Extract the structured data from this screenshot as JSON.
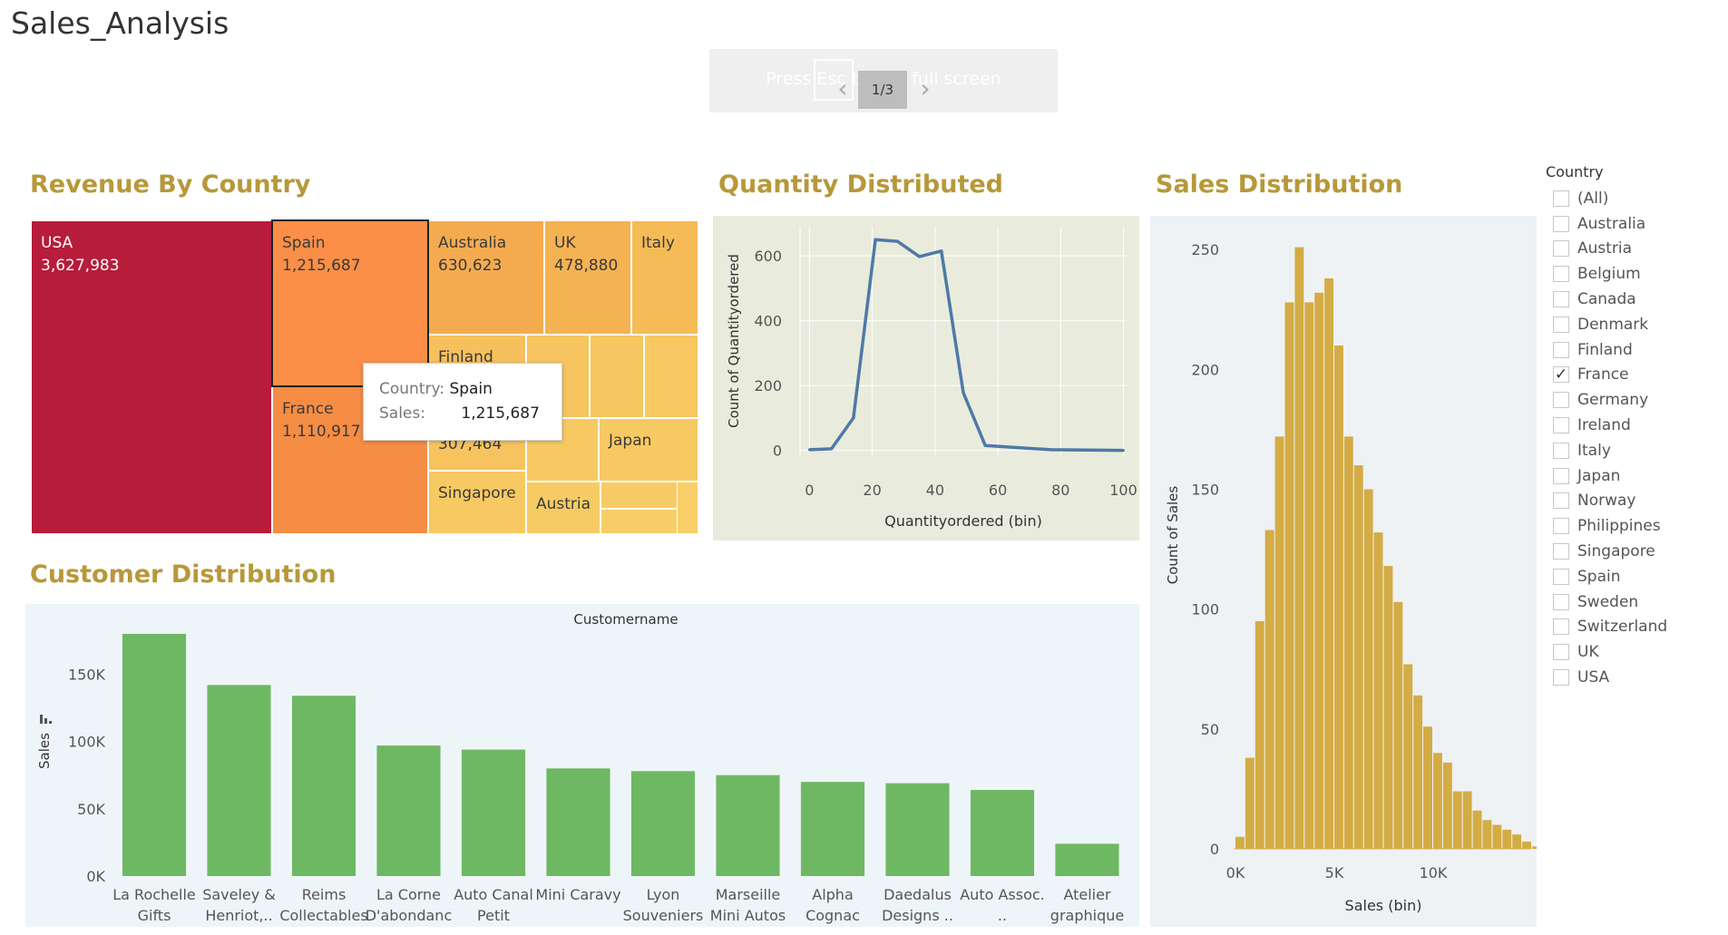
{
  "app": {
    "title": "Sales_Analysis"
  },
  "fullscreen": {
    "text": "Press  Esc  to exit full screen",
    "page_indicator": "1/3"
  },
  "sheets": {
    "revenue_title": "Revenue By Country",
    "quantity_title": "Quantity Distributed",
    "sales_title": "Sales Distribution",
    "customer_title": "Customer Distribution"
  },
  "tooltip": {
    "country_key": "Country:",
    "country_val": "Spain",
    "sales_key": "Sales:",
    "sales_val": "1,215,687"
  },
  "filter": {
    "title": "Country",
    "options": [
      "(All)",
      "Australia",
      "Austria",
      "Belgium",
      "Canada",
      "Denmark",
      "Finland",
      "France",
      "Germany",
      "Ireland",
      "Italy",
      "Japan",
      "Norway",
      "Philippines",
      "Singapore",
      "Spain",
      "Sweden",
      "Switzerland",
      "UK",
      "USA"
    ],
    "selected": [
      "France"
    ]
  },
  "colors": {
    "title_gold": "#b7983a",
    "line_blue": "#4e79a7",
    "bar_green": "#6fb863",
    "hist_gold": "#d4ac45"
  },
  "chart_data": [
    {
      "type": "treemap",
      "title": "Revenue By Country",
      "items": [
        {
          "name": "USA",
          "value": 3627983,
          "label": "3,627,983",
          "color": "#b71c3a"
        },
        {
          "name": "Spain",
          "value": 1215687,
          "label": "1,215,687",
          "color": "#fb8f48"
        },
        {
          "name": "France",
          "value": 1110917,
          "label": "1,110,917",
          "color": "#f68d45"
        },
        {
          "name": "Australia",
          "value": 630623,
          "label": "630,623",
          "color": "#f4ab50"
        },
        {
          "name": "UK",
          "value": 478880,
          "label": "478,880",
          "color": "#f4b253"
        },
        {
          "name": "Italy",
          "value": null,
          "label": "",
          "color": "#f5bb57"
        },
        {
          "name": "Finland",
          "value": null,
          "label": "",
          "color": "#f6c15c"
        },
        {
          "name": "",
          "value": 307464,
          "label": "307,464",
          "color": "#f6c35e"
        },
        {
          "name": "Japan",
          "value": null,
          "label": "",
          "color": "#f7c962"
        },
        {
          "name": "Singapore",
          "value": null,
          "label": "",
          "color": "#f7c962"
        },
        {
          "name": "Austria",
          "value": null,
          "label": "",
          "color": "#f7cb64"
        }
      ]
    },
    {
      "type": "line",
      "title": "Quantity Distributed",
      "xlabel": "Quantityordered (bin)",
      "ylabel": "Count of Quantityordered",
      "x": [
        0,
        7,
        14,
        21,
        28,
        35,
        42,
        49,
        56,
        77,
        100
      ],
      "y": [
        2,
        5,
        100,
        650,
        645,
        598,
        615,
        178,
        15,
        2,
        0
      ],
      "xticks": [
        0,
        20,
        40,
        60,
        80,
        100
      ],
      "yticks": [
        0,
        200,
        400,
        600
      ],
      "xlim": [
        -3,
        101
      ],
      "ylim": [
        -15,
        690
      ],
      "color": "#4e79a7"
    },
    {
      "type": "bar",
      "title": "Sales Distribution",
      "xlabel": "Sales (bin)",
      "ylabel": "Count of Sales",
      "x_start": 0,
      "bin_width": 500,
      "values": [
        5,
        38,
        95,
        133,
        172,
        228,
        251,
        228,
        232,
        238,
        210,
        172,
        160,
        150,
        132,
        118,
        103,
        77,
        64,
        51,
        40,
        36,
        24,
        24,
        16,
        12,
        10,
        8,
        6,
        3,
        1,
        2,
        1,
        1,
        2,
        1,
        0,
        0,
        0,
        0,
        0,
        1,
        0,
        0,
        0,
        0,
        1
      ],
      "xticks": [
        "0K",
        "5K",
        "10K"
      ],
      "yticks": [
        0,
        50,
        100,
        150,
        200,
        250
      ],
      "ylim": [
        0,
        255
      ],
      "color": "#d4ac45"
    },
    {
      "type": "bar",
      "title": "Customer Distribution",
      "header": "Customername",
      "ylabel": "Sales",
      "categories": [
        [
          "La Rochelle",
          "Gifts"
        ],
        [
          "Saveley &",
          "Henriot,.."
        ],
        [
          "Reims",
          "Collectables"
        ],
        [
          "La Corne",
          "D'abondanc"
        ],
        [
          "Auto Canal",
          "Petit"
        ],
        [
          "Mini Caravy",
          ""
        ],
        [
          "Lyon",
          "Souveniers"
        ],
        [
          "Marseille",
          "Mini Autos"
        ],
        [
          "Alpha",
          "Cognac"
        ],
        [
          "Daedalus",
          "Designs .."
        ],
        [
          "Auto Assoc.",
          ".."
        ],
        [
          "Atelier",
          "graphique"
        ]
      ],
      "values": [
        180000,
        142000,
        134000,
        97000,
        94000,
        80000,
        78000,
        75000,
        70000,
        69000,
        64000,
        24000
      ],
      "yticks": [
        0,
        50000,
        100000,
        150000
      ],
      "ytick_labels": [
        "0K",
        "50K",
        "100K",
        "150K"
      ],
      "ylim": [
        0,
        182000
      ],
      "color": "#6fb863"
    }
  ]
}
